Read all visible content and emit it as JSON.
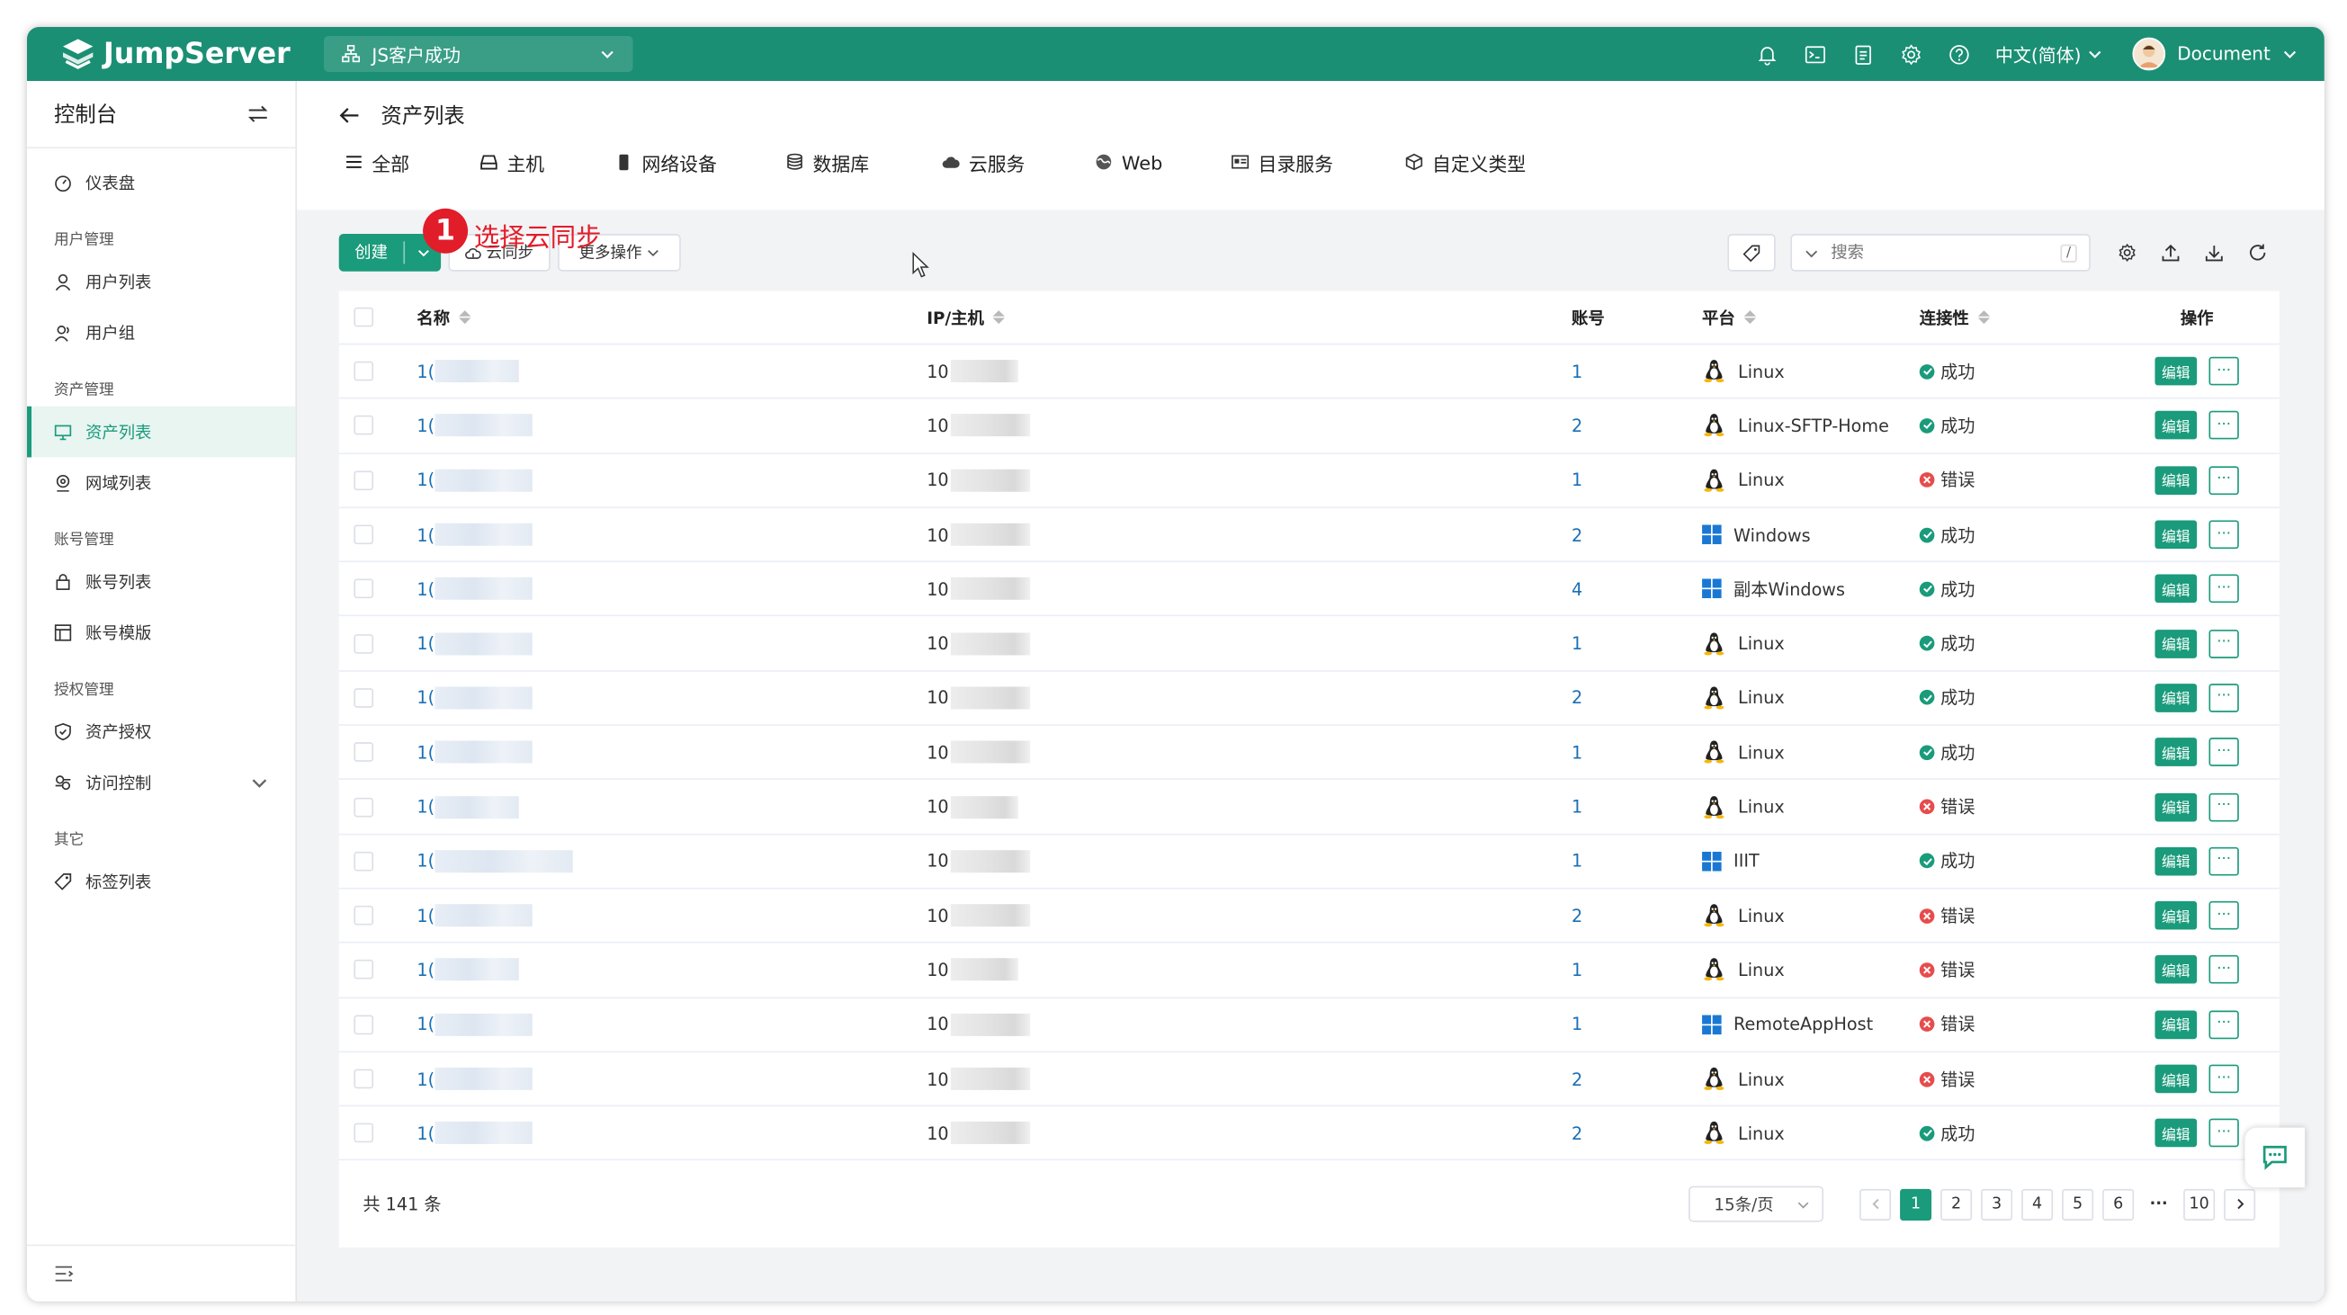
{
  "header": {
    "brand": "JumpServer",
    "org": "JS客户成功",
    "language": "中文(简体)",
    "user": "Document",
    "icons": [
      "bell-icon",
      "terminal-icon",
      "clipboard-icon",
      "gear-icon",
      "help-icon"
    ]
  },
  "sidebar": {
    "title": "控制台",
    "sections": [
      {
        "items": [
          {
            "label": "仪表盘",
            "icon": "dashboard-icon"
          }
        ]
      },
      {
        "title": "用户管理",
        "items": [
          {
            "label": "用户列表",
            "icon": "user-icon"
          },
          {
            "label": "用户组",
            "icon": "users-icon"
          }
        ]
      },
      {
        "title": "资产管理",
        "items": [
          {
            "label": "资产列表",
            "icon": "monitor-icon",
            "active": true
          },
          {
            "label": "网域列表",
            "icon": "location-icon"
          }
        ]
      },
      {
        "title": "账号管理",
        "items": [
          {
            "label": "账号列表",
            "icon": "lock-icon"
          },
          {
            "label": "账号模版",
            "icon": "template-icon"
          }
        ]
      },
      {
        "title": "授权管理",
        "items": [
          {
            "label": "资产授权",
            "icon": "shield-icon"
          },
          {
            "label": "访问控制",
            "icon": "access-icon",
            "expandable": true
          }
        ]
      },
      {
        "title": "其它",
        "items": [
          {
            "label": "标签列表",
            "icon": "tag-icon"
          }
        ]
      }
    ]
  },
  "page": {
    "title": "资产列表",
    "tabs": [
      {
        "label": "全部",
        "icon": "list-icon"
      },
      {
        "label": "主机",
        "icon": "host-icon"
      },
      {
        "label": "网络设备",
        "icon": "device-icon"
      },
      {
        "label": "数据库",
        "icon": "database-icon"
      },
      {
        "label": "云服务",
        "icon": "cloud-icon"
      },
      {
        "label": "Web",
        "icon": "globe-icon"
      },
      {
        "label": "目录服务",
        "icon": "directory-icon"
      },
      {
        "label": "自定义类型",
        "icon": "cube-icon"
      }
    ]
  },
  "toolbar": {
    "create": "创建",
    "cloud_sync": "云同步",
    "more_actions": "更多操作",
    "search_placeholder": "搜索",
    "search_shortcut": "/"
  },
  "annotation": {
    "number": "1",
    "text": "选择云同步"
  },
  "table": {
    "columns": {
      "name": "名称",
      "ip": "IP/主机",
      "accounts": "账号",
      "platform": "平台",
      "connectivity": "连接性",
      "actions": "操作"
    },
    "edit_label": "编辑",
    "more_label": "···",
    "rows": [
      {
        "name": "1(",
        "ip": "10",
        "accounts": "1",
        "platform": "Linux",
        "os": "linux",
        "status": "成功",
        "ok": true
      },
      {
        "name": "1(",
        "ip": "10",
        "accounts": "2",
        "platform": "Linux-SFTP-Home",
        "os": "linux",
        "status": "成功",
        "ok": true
      },
      {
        "name": "1(",
        "ip": "10",
        "accounts": "1",
        "platform": "Linux",
        "os": "linux",
        "status": "错误",
        "ok": false
      },
      {
        "name": "1(",
        "ip": "10",
        "accounts": "2",
        "platform": "Windows",
        "os": "windows",
        "status": "成功",
        "ok": true
      },
      {
        "name": "1(",
        "ip": "10",
        "accounts": "4",
        "platform": "副本Windows",
        "os": "windows",
        "status": "成功",
        "ok": true
      },
      {
        "name": "1(",
        "ip": "10",
        "accounts": "1",
        "platform": "Linux",
        "os": "linux",
        "status": "成功",
        "ok": true
      },
      {
        "name": "1(",
        "ip": "10",
        "accounts": "2",
        "platform": "Linux",
        "os": "linux",
        "status": "成功",
        "ok": true
      },
      {
        "name": "1(",
        "ip": "10",
        "accounts": "1",
        "platform": "Linux",
        "os": "linux",
        "status": "成功",
        "ok": true
      },
      {
        "name": "1(",
        "ip": "10",
        "accounts": "1",
        "platform": "Linux",
        "os": "linux",
        "status": "错误",
        "ok": false
      },
      {
        "name": "1(",
        "ip": "10",
        "accounts": "1",
        "platform": "IIIT",
        "os": "windows",
        "status": "成功",
        "ok": true
      },
      {
        "name": "1(",
        "ip": "10",
        "accounts": "2",
        "platform": "Linux",
        "os": "linux",
        "status": "错误",
        "ok": false
      },
      {
        "name": "1(",
        "ip": "10",
        "accounts": "1",
        "platform": "Linux",
        "os": "linux",
        "status": "错误",
        "ok": false
      },
      {
        "name": "1(",
        "ip": "10",
        "accounts": "1",
        "platform": "RemoteAppHost",
        "os": "windows",
        "status": "错误",
        "ok": false
      },
      {
        "name": "1(",
        "ip": "10",
        "accounts": "2",
        "platform": "Linux",
        "os": "linux",
        "status": "错误",
        "ok": false
      },
      {
        "name": "1(",
        "ip": "10",
        "accounts": "2",
        "platform": "Linux",
        "os": "linux",
        "status": "成功",
        "ok": true
      }
    ]
  },
  "footer": {
    "total": "共 141 条",
    "page_size": "15条/页",
    "pages": [
      "1",
      "2",
      "3",
      "4",
      "5",
      "6",
      "···",
      "10"
    ],
    "current_page": "1"
  },
  "colors": {
    "brand": "#1a8f74",
    "accent": "#1a9b7b",
    "error": "#e74c4c",
    "annotation": "#e11d2a",
    "link": "#1a6fb5"
  }
}
